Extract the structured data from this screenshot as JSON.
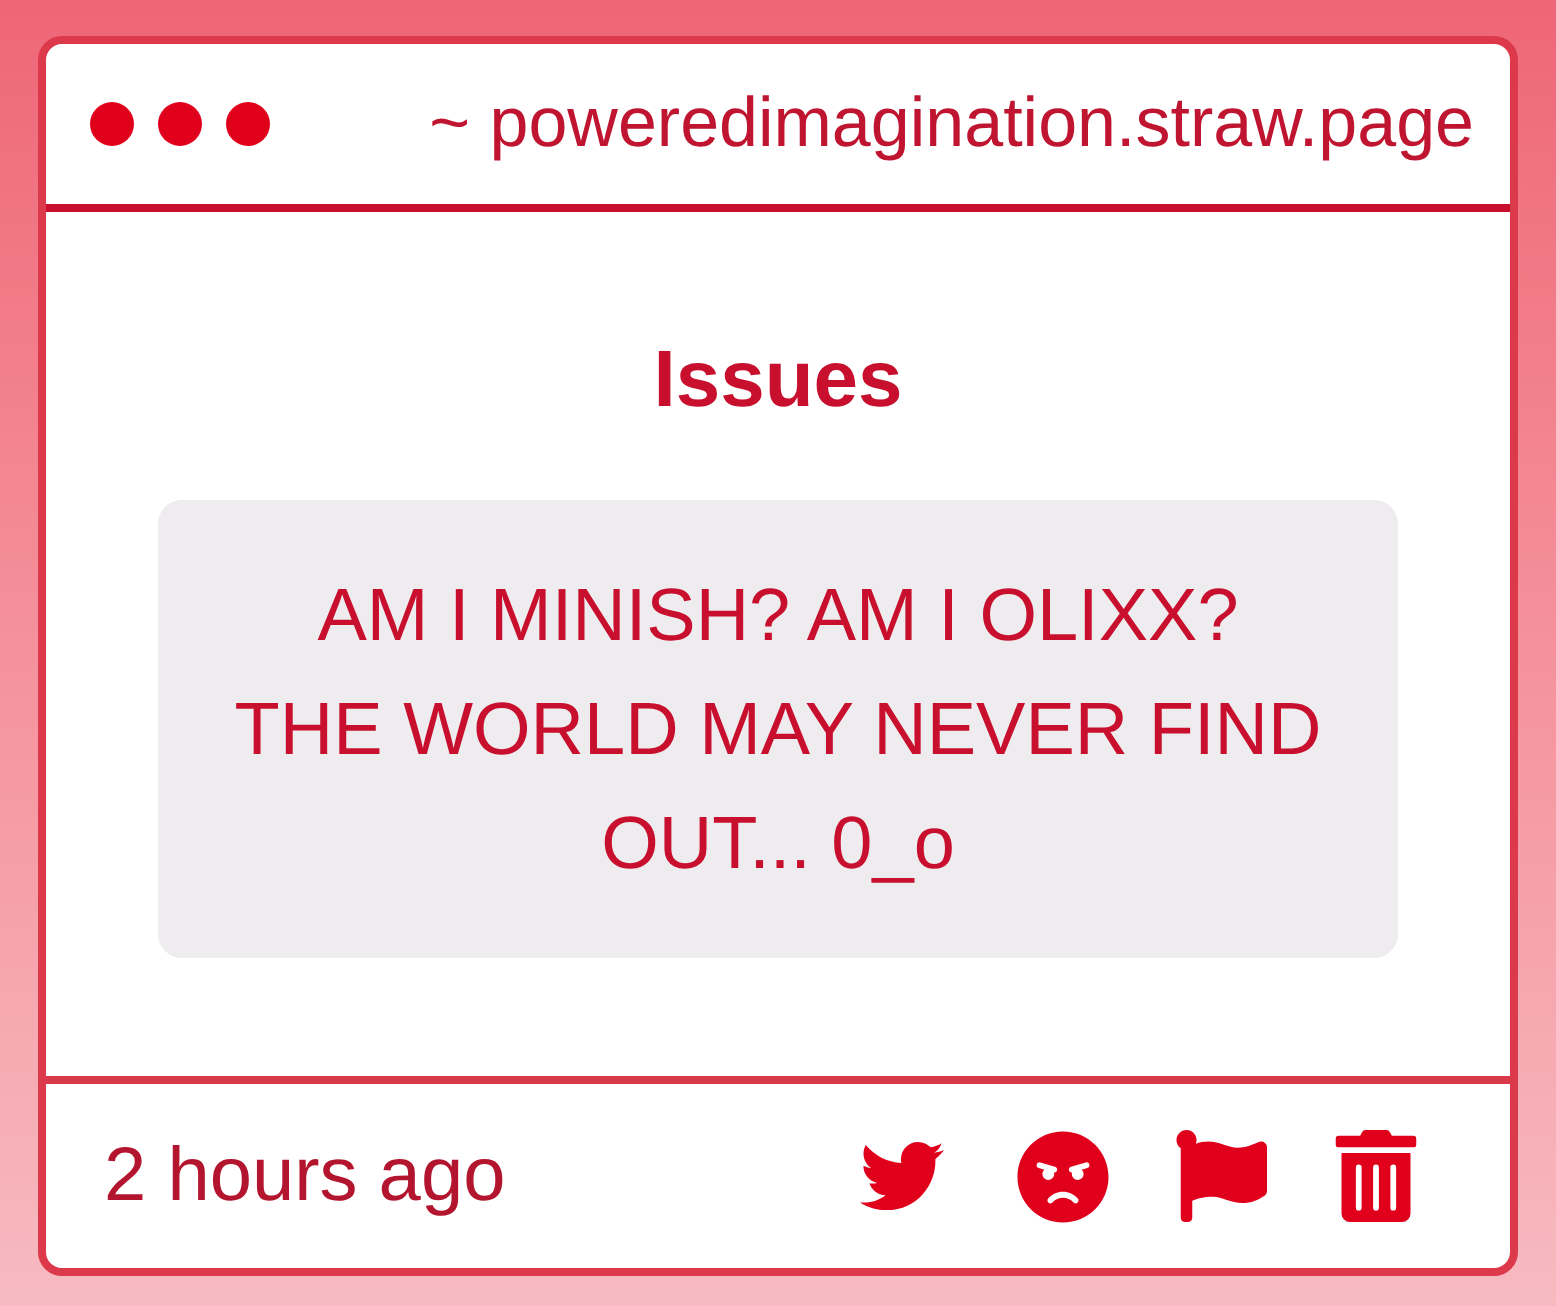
{
  "window": {
    "title": "~ poweredimagination.straw.page"
  },
  "post": {
    "heading": "Issues",
    "message_lines": [
      "AM I MINISH? AM I OLIXX?",
      "THE WORLD MAY NEVER FIND",
      "OUT... 0_o"
    ]
  },
  "footer": {
    "time": "2 hours ago"
  }
}
